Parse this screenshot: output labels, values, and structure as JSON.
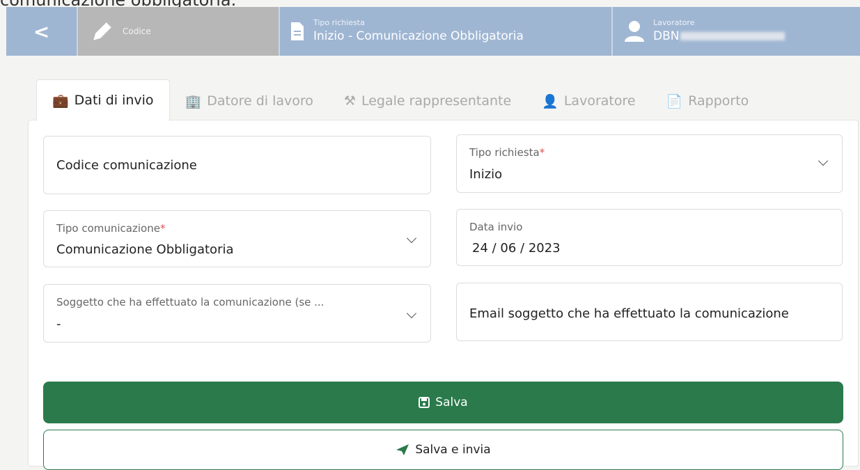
{
  "page_header_text": "comunicazione obbligatoria.",
  "header": {
    "back_label": "<",
    "codice_label": "Codice",
    "tipo_small": "Tipo richiesta",
    "tipo_value": "Inizio - Comunicazione Obbligatoria",
    "lavoratore_small": "Lavoratore",
    "lavoratore_value": "DBN"
  },
  "tabs": [
    {
      "label": "Dati di invio",
      "icon": "briefcase-icon"
    },
    {
      "label": "Datore di lavoro",
      "icon": "building-icon"
    },
    {
      "label": "Legale rappresentante",
      "icon": "gavel-icon"
    },
    {
      "label": "Lavoratore",
      "icon": "user-icon"
    },
    {
      "label": "Rapporto",
      "icon": "file-icon"
    }
  ],
  "fields": {
    "codice_comunicazione": "Codice comunicazione",
    "tipo_richiesta_label": "Tipo richiesta",
    "tipo_richiesta_value": "Inizio",
    "tipo_comunicazione_label": "Tipo comunicazione",
    "tipo_comunicazione_value": "Comunicazione Obbligatoria",
    "data_invio_label": "Data invio",
    "data_invio_value": "24 / 06 / 2023",
    "soggetto_label": "Soggetto che ha effettuato la comunicazione (se ...",
    "soggetto_value": "-",
    "email_soggetto": "Email soggetto che ha effettuato la comunicazione"
  },
  "required_mark": "*",
  "buttons": {
    "salva": "Salva",
    "salva_invia": "Salva e invia"
  },
  "colors": {
    "header_bg": "#9fb6d3",
    "primary_green": "#2a7a4b"
  }
}
